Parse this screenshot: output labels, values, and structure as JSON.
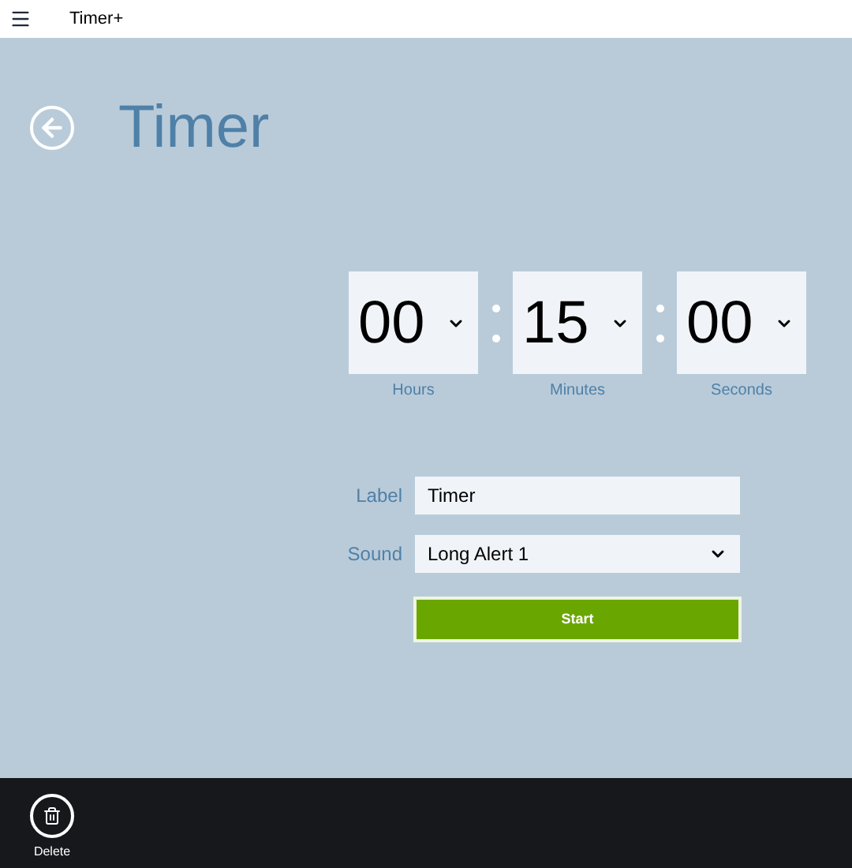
{
  "window": {
    "title": "Timer+"
  },
  "page": {
    "title": "Timer"
  },
  "spinners": [
    {
      "value": "00",
      "caption": "Hours"
    },
    {
      "value": "15",
      "caption": "Minutes"
    },
    {
      "value": "00",
      "caption": "Seconds"
    }
  ],
  "form": {
    "label_caption": "Label",
    "label_value": "Timer",
    "sound_caption": "Sound",
    "sound_value": "Long Alert 1",
    "start": "Start"
  },
  "app_bar": [
    {
      "label": "Delete"
    }
  ]
}
